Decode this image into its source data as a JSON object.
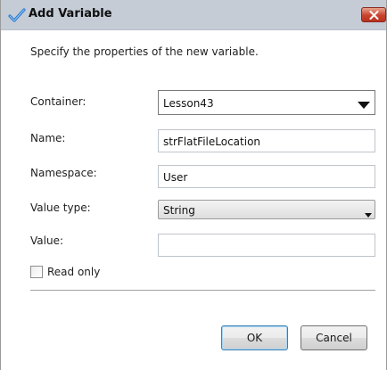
{
  "window": {
    "title": "Add Variable",
    "title_icon": "checkmark-icon",
    "close_icon": "close-icon",
    "close_color": "#c9432d"
  },
  "instructions": "Specify the properties of the new variable.",
  "form": {
    "container": {
      "label": "Container:",
      "value": "Lesson43"
    },
    "name": {
      "label": "Name:",
      "value": "strFlatFileLocation"
    },
    "namespace": {
      "label": "Namespace:",
      "value": "User"
    },
    "value_type": {
      "label": "Value type:",
      "value": "String"
    },
    "value": {
      "label": "Value:",
      "value": ""
    },
    "read_only": {
      "label": "Read only",
      "checked": false
    }
  },
  "buttons": {
    "ok": "OK",
    "cancel": "Cancel"
  }
}
